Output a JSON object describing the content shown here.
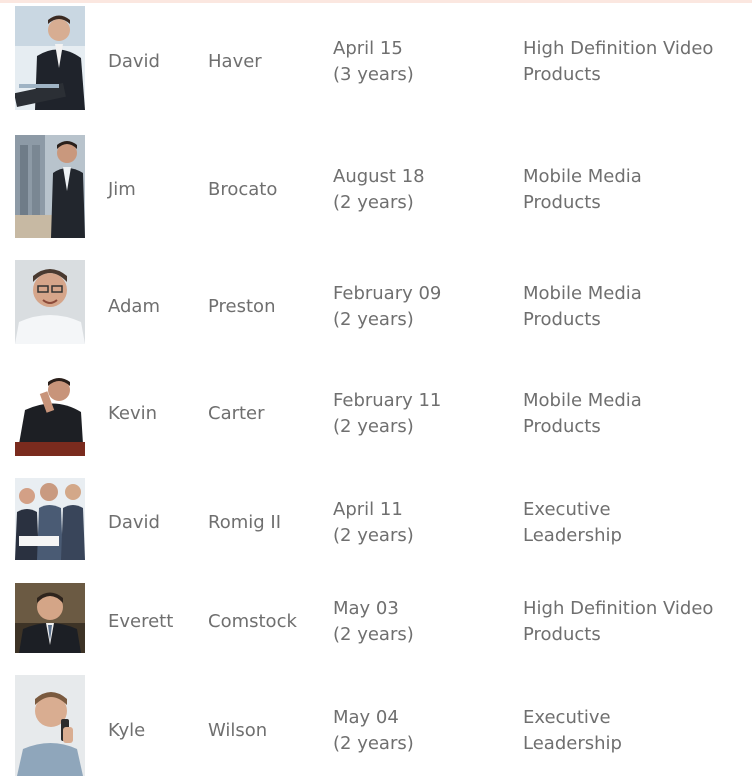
{
  "employees": [
    {
      "first": "David",
      "last": "Haver",
      "date": "April 15",
      "tenure": "(3 years)",
      "dept1": "High Definition Video",
      "dept2": "Products",
      "photo": "man-in-suit-with-laptop-photo"
    },
    {
      "first": "Jim",
      "last": "Brocato",
      "date": "August 18",
      "tenure": "(2 years)",
      "dept1": "Mobile Media",
      "dept2": "Products",
      "photo": "man-in-suit-by-window-photo"
    },
    {
      "first": "Adam",
      "last": "Preston",
      "date": "February 09",
      "tenure": "(2 years)",
      "dept1": "Mobile Media",
      "dept2": "Products",
      "photo": "smiling-man-with-glasses-photo"
    },
    {
      "first": "Kevin",
      "last": "Carter",
      "date": "February 11",
      "tenure": "(2 years)",
      "dept1": "Mobile Media",
      "dept2": "Products",
      "photo": "man-on-phone-at-desk-photo"
    },
    {
      "first": "David",
      "last": "Romig II",
      "date": "April 11",
      "tenure": "(2 years)",
      "dept1": "Executive",
      "dept2": "Leadership",
      "photo": "business-team-meeting-photo"
    },
    {
      "first": "Everett",
      "last": "Comstock",
      "date": "May 03",
      "tenure": "(2 years)",
      "dept1": "High Definition Video",
      "dept2": "Products",
      "photo": "man-in-suit-portrait-photo"
    },
    {
      "first": "Kyle",
      "last": "Wilson",
      "date": "May 04",
      "tenure": "(2 years)",
      "dept1": "Executive",
      "dept2": "Leadership",
      "photo": "man-on-phone-smiling-photo"
    }
  ]
}
